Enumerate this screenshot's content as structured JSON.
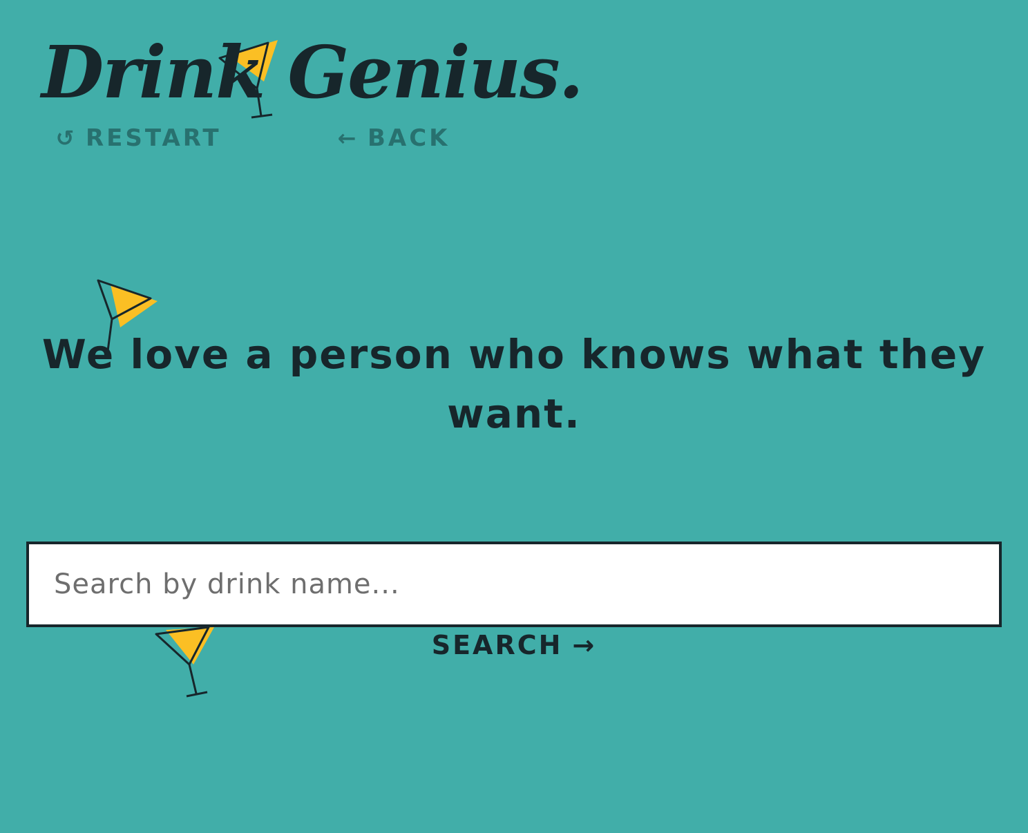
{
  "brand": {
    "logo_text": "Drink Genius."
  },
  "nav": {
    "restart_icon": "restart-icon",
    "restart_label": "RESTART",
    "back_icon": "back-arrow-icon",
    "back_label": "BACK"
  },
  "main": {
    "headline": "We love a person who knows what they want.",
    "search_placeholder": "Search by drink name...",
    "search_value": "",
    "search_button_label": "SEARCH",
    "search_button_icon": "right-arrow-icon"
  },
  "colors": {
    "background": "#41AEA9",
    "text_dark": "#17262B",
    "nav_text": "#28716F",
    "cocktail_fill": "#FBBF24",
    "input_background": "#FFFFFF"
  }
}
